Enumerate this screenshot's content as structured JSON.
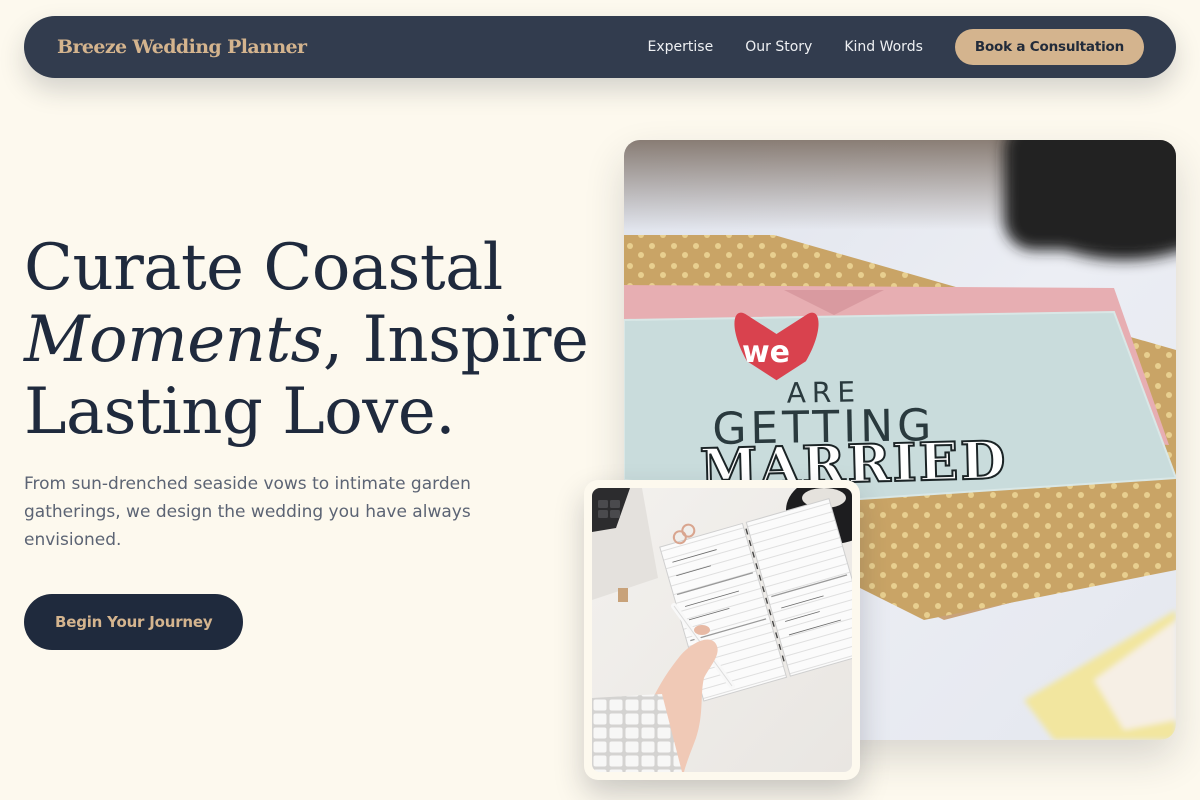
{
  "nav": {
    "brand": "Breeze Wedding Planner",
    "links": [
      {
        "label": "Expertise"
      },
      {
        "label": "Our Story"
      },
      {
        "label": "Kind Words"
      }
    ],
    "cta_label": "Book a Consultation"
  },
  "hero": {
    "title_line1": "Curate Coastal",
    "title_emphasis": "Moments",
    "title_line2_rest": ", Inspire",
    "title_line3": "Lasting Love.",
    "subtitle": "From sun-drenched seaside vows to intimate garden gatherings, we design the wedding you have always envisioned.",
    "cta_label": "Begin Your Journey"
  },
  "images": {
    "main": {
      "card_word": "we",
      "card_line1": "ARE",
      "card_line2": "GETTING",
      "card_line3": "MARRIED"
    },
    "secondary": {}
  },
  "colors": {
    "background": "#fdf9ee",
    "navy": "#1f2a3d",
    "nav_bar": "#323c4e",
    "gold": "#d4b48e",
    "body_text": "#5c6474"
  }
}
